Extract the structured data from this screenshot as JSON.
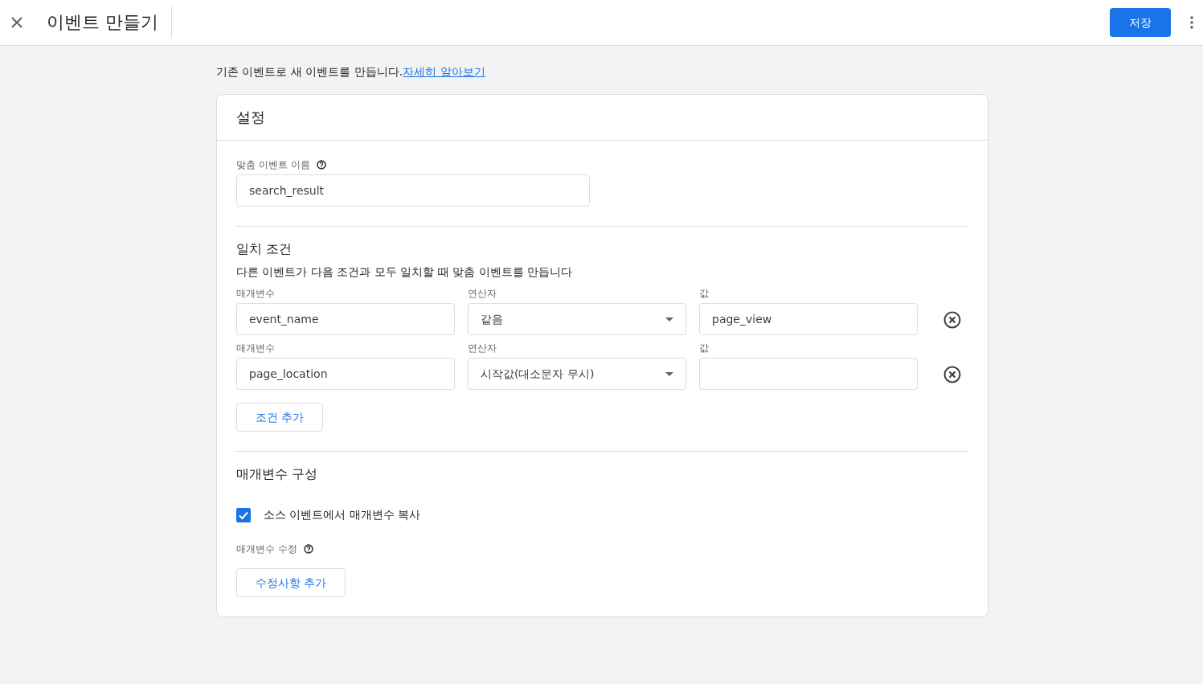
{
  "header": {
    "title": "이벤트 만들기",
    "save_button": "저장"
  },
  "intro": {
    "text": "기존 이벤트로 새 이벤트를 만듭니다.",
    "link": "자세히 알아보기"
  },
  "card": {
    "title": "설정",
    "name_field": {
      "label": "맞춤 이벤트 이름",
      "value": "search_result"
    },
    "conditions": {
      "title": "일치 조건",
      "description": "다른 이벤트가 다음 조건과 모두 일치할 때 맞춤 이벤트를 만듭니다",
      "rows": [
        {
          "parameter_label": "매개변수",
          "parameter": "event_name",
          "operator_label": "연산자",
          "operator": "같음",
          "value_label": "값",
          "value": "page_view"
        },
        {
          "parameter_label": "매개변수",
          "parameter": "page_location",
          "operator_label": "연산자",
          "operator": "시작값(대소문자 무시)",
          "value_label": "값"
        }
      ],
      "add_button": "조건 추가"
    },
    "parameters": {
      "title": "매개변수 구성",
      "copy_checkbox": {
        "label": "소스 이벤트에서 매개변수 복사",
        "checked": true
      },
      "modify_label": "매개변수 수정",
      "add_button": "수정사항 추가"
    }
  }
}
